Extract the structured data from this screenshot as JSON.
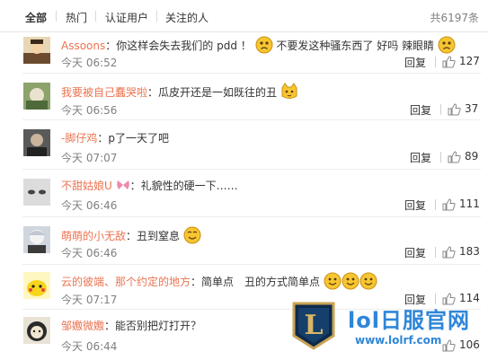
{
  "tabs": [
    {
      "label": "全部"
    },
    {
      "label": "热门"
    },
    {
      "label": "认证用户"
    },
    {
      "label": "关注的人"
    }
  ],
  "total": "共6197条",
  "actions": {
    "reply": "回复"
  },
  "comments": [
    {
      "user": "Assoons",
      "text_a": "：你这样会失去我们的 pdd ！",
      "text_b": "不要发这种骚东西了 好吗 辣眼睛",
      "time": "今天 06:52",
      "likes": "127"
    },
    {
      "user": "我要被自己蠢哭啦",
      "text_a": "：瓜皮开还是一如既往的丑",
      "time": "今天 06:56",
      "likes": "37"
    },
    {
      "user": "-脚仔鸡",
      "text_a": "：p了一天了吧",
      "time": "今天 07:07",
      "likes": "89"
    },
    {
      "user": "不甜姑娘U",
      "text_a": "：礼貌性的硬一下……",
      "time": "今天 06:46",
      "likes": "111"
    },
    {
      "user": "萌萌的小无敌",
      "text_a": "：丑到窒息",
      "time": "今天 06:46",
      "likes": "183"
    },
    {
      "user": "云的彼端、那个约定的地方",
      "text_a": "：简单点　丑的方式简单点",
      "time": "今天 07:17",
      "likes": "114"
    },
    {
      "user": "邹嫐微嫐",
      "text_a": "：能否别把灯打开？",
      "time": "今天 06:44",
      "likes": "106"
    }
  ],
  "watermark": {
    "title": "lol日服官网",
    "url": "www.lolrf.com",
    "badge_letter": "L"
  },
  "colors": {
    "username": "#eb7350",
    "watermark": "#2f86d8"
  }
}
